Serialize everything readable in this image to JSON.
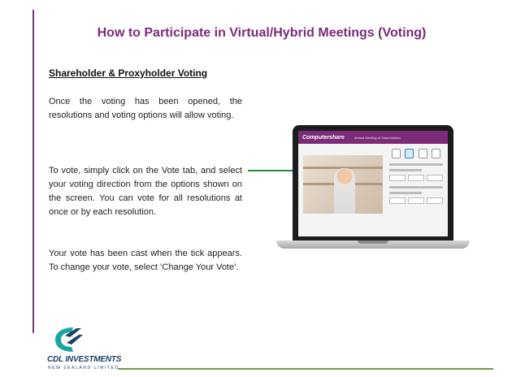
{
  "slide": {
    "title": "How to Participate in Virtual/Hybrid Meetings (Voting)",
    "subheading": "Shareholder & Proxyholder Voting",
    "paragraphs": [
      "Once the voting has been opened, the resolutions and voting options will allow voting.",
      "To vote, simply click on the Vote tab, and select your voting direction from the options shown on the screen. You can vote for all resolutions at once or by each resolution.",
      "Your vote has been cast when the tick appears. To change your vote, select ‘Change Your Vote’."
    ]
  },
  "laptop_screen": {
    "brand": "Computershare",
    "app_title": "Annual Meeting of Shareholders"
  },
  "logo": {
    "name": "CDL INVESTMENTS",
    "subtitle": "NEW ZEALAND LIMITED"
  },
  "colors": {
    "title": "#7b2b78",
    "accent_bar": "#7a3a78",
    "bottom_rule": "#6e9a45",
    "pointer": "#2a8a3a",
    "logo_navy": "#1f3f66",
    "logo_teal": "#1aa6a0"
  }
}
